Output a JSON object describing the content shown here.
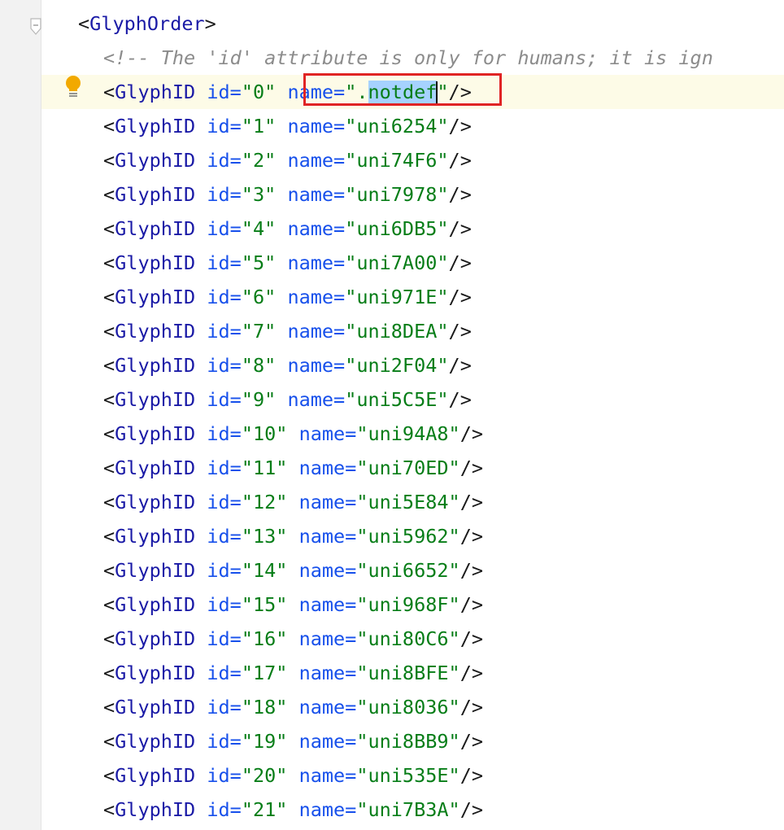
{
  "editor": {
    "open_tag": "GlyphOrder",
    "comment": "<!-- The 'id' attribute is only for humans; it is ign",
    "element_tag": "GlyphID",
    "attr_id": "id",
    "attr_name": "name",
    "first_glyph": {
      "id": "0",
      "name_prefix": ".",
      "name_selected": "notdef"
    },
    "glyphs": [
      {
        "id": "1",
        "name": "uni6254"
      },
      {
        "id": "2",
        "name": "uni74F6"
      },
      {
        "id": "3",
        "name": "uni7978"
      },
      {
        "id": "4",
        "name": "uni6DB5"
      },
      {
        "id": "5",
        "name": "uni7A00"
      },
      {
        "id": "6",
        "name": "uni971E"
      },
      {
        "id": "7",
        "name": "uni8DEA"
      },
      {
        "id": "8",
        "name": "uni2F04"
      },
      {
        "id": "9",
        "name": "uni5C5E"
      },
      {
        "id": "10",
        "name": "uni94A8"
      },
      {
        "id": "11",
        "name": "uni70ED"
      },
      {
        "id": "12",
        "name": "uni5E84"
      },
      {
        "id": "13",
        "name": "uni5962"
      },
      {
        "id": "14",
        "name": "uni6652"
      },
      {
        "id": "15",
        "name": "uni968F"
      },
      {
        "id": "16",
        "name": "uni80C6"
      },
      {
        "id": "17",
        "name": "uni8BFE"
      },
      {
        "id": "18",
        "name": "uni8036"
      },
      {
        "id": "19",
        "name": "uni8BB9"
      },
      {
        "id": "20",
        "name": "uni535E"
      },
      {
        "id": "21",
        "name": "uni7B3A"
      }
    ]
  },
  "gutter": {
    "fold_icon": "fold-collapse-icon",
    "intention_icon": "lightbulb-icon"
  },
  "colors": {
    "tag": "#1a1aa6",
    "attribute": "#1750eb",
    "value": "#067d17",
    "comment": "#8c8c8c",
    "selection": "#a6d2ff",
    "highlight_box": "#e02424"
  }
}
